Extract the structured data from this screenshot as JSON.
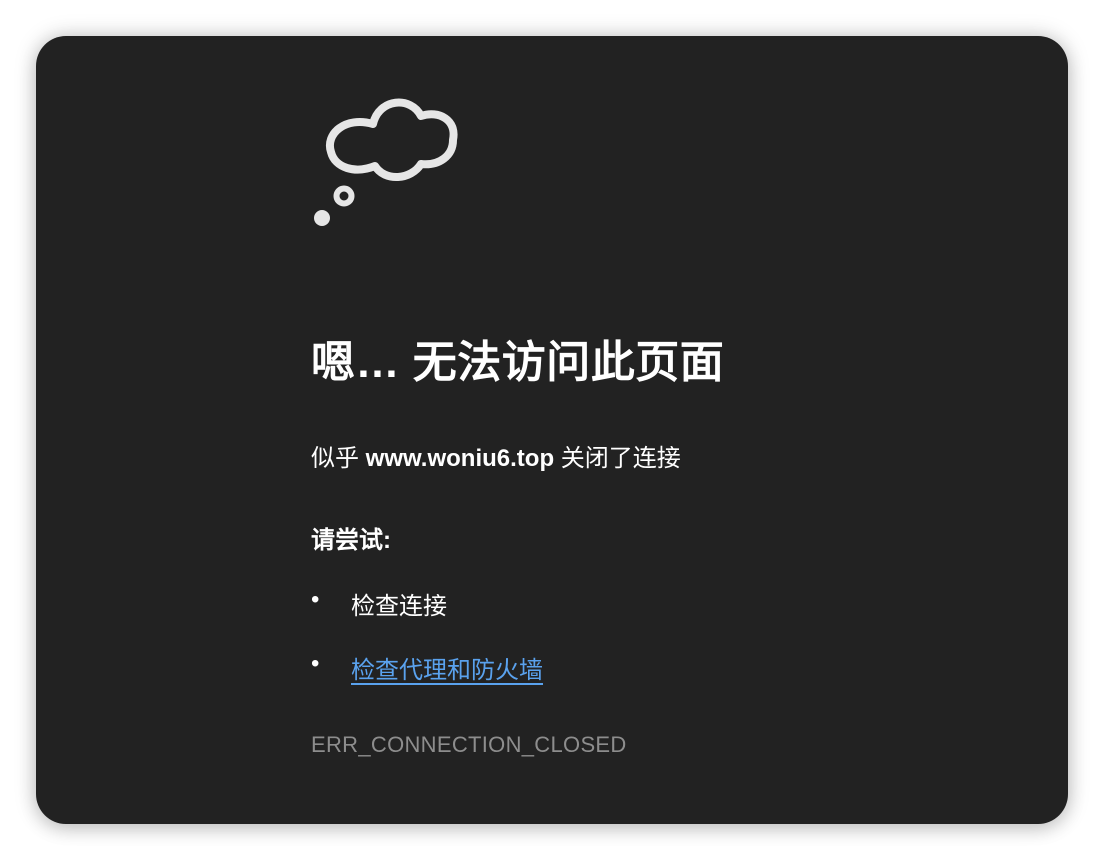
{
  "icon": "thought-cloud-icon",
  "title": "嗯… 无法访问此页面",
  "message": {
    "prefix": "似乎 ",
    "host": "www.woniu6.top",
    "suffix": " 关闭了连接"
  },
  "try_heading": "请尝试:",
  "suggestions": [
    {
      "bullet": "•",
      "label": "检查连接",
      "is_link": false
    },
    {
      "bullet": "•",
      "label": "检查代理和防火墙",
      "is_link": true
    }
  ],
  "error_code": "ERR_CONNECTION_CLOSED",
  "colors": {
    "background": "#222222",
    "text": "#ffffff",
    "link": "#5aa2ee",
    "error_code": "#8d8d8d"
  }
}
